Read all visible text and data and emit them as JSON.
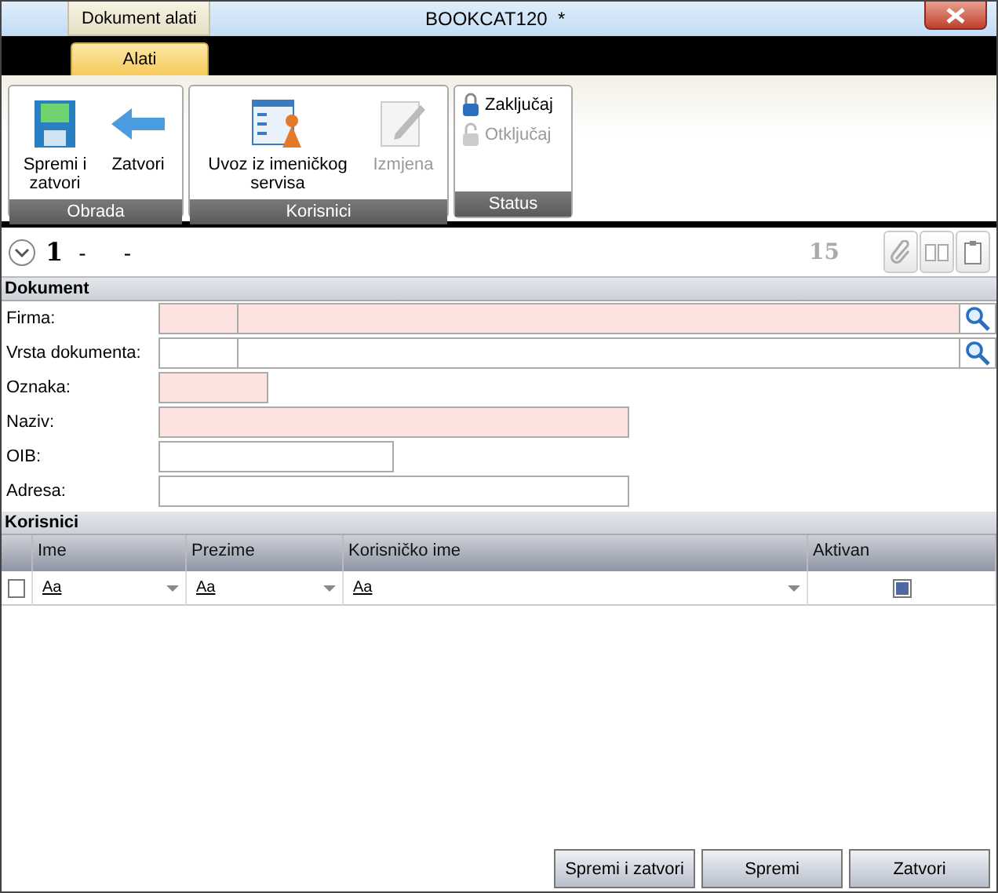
{
  "window": {
    "title": "BOOKCAT120  *",
    "context_tab": "Dokument alati"
  },
  "ribbon_tabs": [
    {
      "label": "Alati",
      "selected": true
    }
  ],
  "ribbon_groups": [
    {
      "title": "Obrada",
      "buttons": [
        {
          "kind": "save",
          "label": "Spremi i zatvori",
          "disabled": false
        },
        {
          "kind": "back",
          "label": "Zatvori",
          "disabled": false
        }
      ]
    },
    {
      "title": "Korisnici",
      "buttons": [
        {
          "kind": "import",
          "label": "Uvoz iz imeničkog servisa",
          "disabled": false
        },
        {
          "kind": "edit",
          "label": "Izmjena",
          "disabled": true
        }
      ]
    },
    {
      "title": "Status",
      "buttons": [
        {
          "kind": "lock",
          "label": "Zaključaj",
          "disabled": false
        },
        {
          "kind": "unlock",
          "label": "Otključaj",
          "disabled": true
        }
      ]
    }
  ],
  "record": {
    "number": "1",
    "dash_1": "-",
    "dash_2": "-",
    "count": "15"
  },
  "sections": [
    {
      "title": "Dokument",
      "fields": [
        {
          "label": "Firma:",
          "kind": "lookup",
          "required": true
        },
        {
          "label": "Vrsta dokumenta:",
          "kind": "lookup",
          "required": false
        },
        {
          "label": "Oznaka:",
          "kind": "short",
          "required": true
        },
        {
          "label": "Naziv:",
          "kind": "long",
          "required": true
        },
        {
          "label": "OIB:",
          "kind": "medium",
          "required": false
        },
        {
          "label": "Adresa:",
          "kind": "long",
          "required": false
        }
      ]
    }
  ],
  "users": {
    "title": "Korisnici",
    "columns": [
      "Ime",
      "Prezime",
      "Korisničko ime",
      "Aktivan"
    ],
    "filter_row": {
      "checked": false,
      "cells": [
        {
          "kind": "text",
          "placeholder": "Aa"
        },
        {
          "kind": "text",
          "placeholder": "Aa"
        },
        {
          "kind": "text",
          "placeholder": "Aa"
        },
        {
          "kind": "check",
          "checked": true
        }
      ]
    }
  },
  "buttons": [
    "Spremi i zatvori",
    "Spremi",
    "Zatvori"
  ]
}
